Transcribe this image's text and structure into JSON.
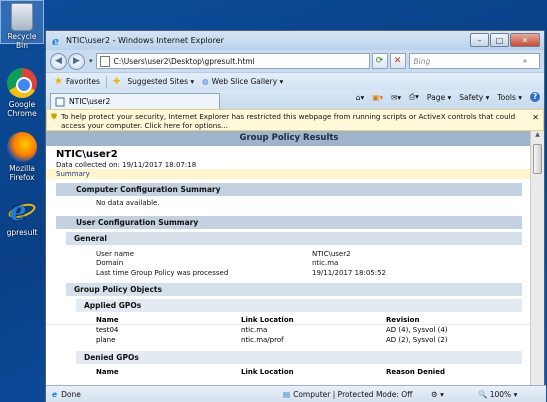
{
  "desktop": {
    "icons": [
      {
        "label": "Recycle Bin",
        "icon": "recycle-bin-icon"
      },
      {
        "label": "Google Chrome",
        "icon": "chrome-icon"
      },
      {
        "label": "Mozilla Firefox",
        "icon": "firefox-icon"
      },
      {
        "label": "gpresult",
        "icon": "ie-shortcut-icon"
      }
    ]
  },
  "window": {
    "title": "NTIC\\user2 - Windows Internet Explorer",
    "controls": {
      "minimize": "–",
      "maximize": "□",
      "close": "✕"
    }
  },
  "address_bar": {
    "back": "◀",
    "forward": "▶",
    "url": "C:\\Users\\user2\\Desktop\\gpresult.html",
    "search_placeholder": "Bing"
  },
  "favorites_bar": {
    "favorites": "Favorites",
    "suggested_sites": "Suggested Sites ▾",
    "web_slice_gallery": "Web Slice Gallery ▾"
  },
  "tab": {
    "label": "NTIC\\user2"
  },
  "command_bar": {
    "page": "Page ▾",
    "safety": "Safety ▾",
    "tools": "Tools ▾",
    "help": "?"
  },
  "infobar": {
    "text": "To help protect your security, Internet Explorer has restricted this webpage from running scripts or ActiveX controls that could access your computer. Click here for options..."
  },
  "report": {
    "header": "Group Policy Results",
    "user": "NTIC\\user2",
    "data_collected": "Data collected on: 19/11/2017 18:07:18",
    "summary_link": "Summary",
    "computer_config_summary": "Computer Configuration Summary",
    "no_data": "No data available.",
    "user_config_summary": "User Configuration Summary",
    "general": "General",
    "general_rows": [
      {
        "key": "User name",
        "value": "NTIC\\user2"
      },
      {
        "key": "Domain",
        "value": "ntic.ma"
      },
      {
        "key": "Last time Group Policy was processed",
        "value": "19/11/2017 18:05:52"
      }
    ],
    "gpo_section": "Group Policy Objects",
    "applied_gpos": "Applied GPOs",
    "applied_columns": [
      "Name",
      "Link Location",
      "Revision"
    ],
    "applied_rows": [
      {
        "name": "test04",
        "link": "ntic.ma",
        "rev": "AD (4), Sysvol (4)"
      },
      {
        "name": "plane",
        "link": "ntic.ma/prof",
        "rev": "AD (2), Sysvol (2)"
      }
    ],
    "denied_gpos": "Denied GPOs",
    "denied_columns": [
      "Name",
      "Link Location",
      "Reason Denied"
    ]
  },
  "status_bar": {
    "done": "Done",
    "zone": "Computer | Protected Mode: Off",
    "zoom": "100%"
  }
}
